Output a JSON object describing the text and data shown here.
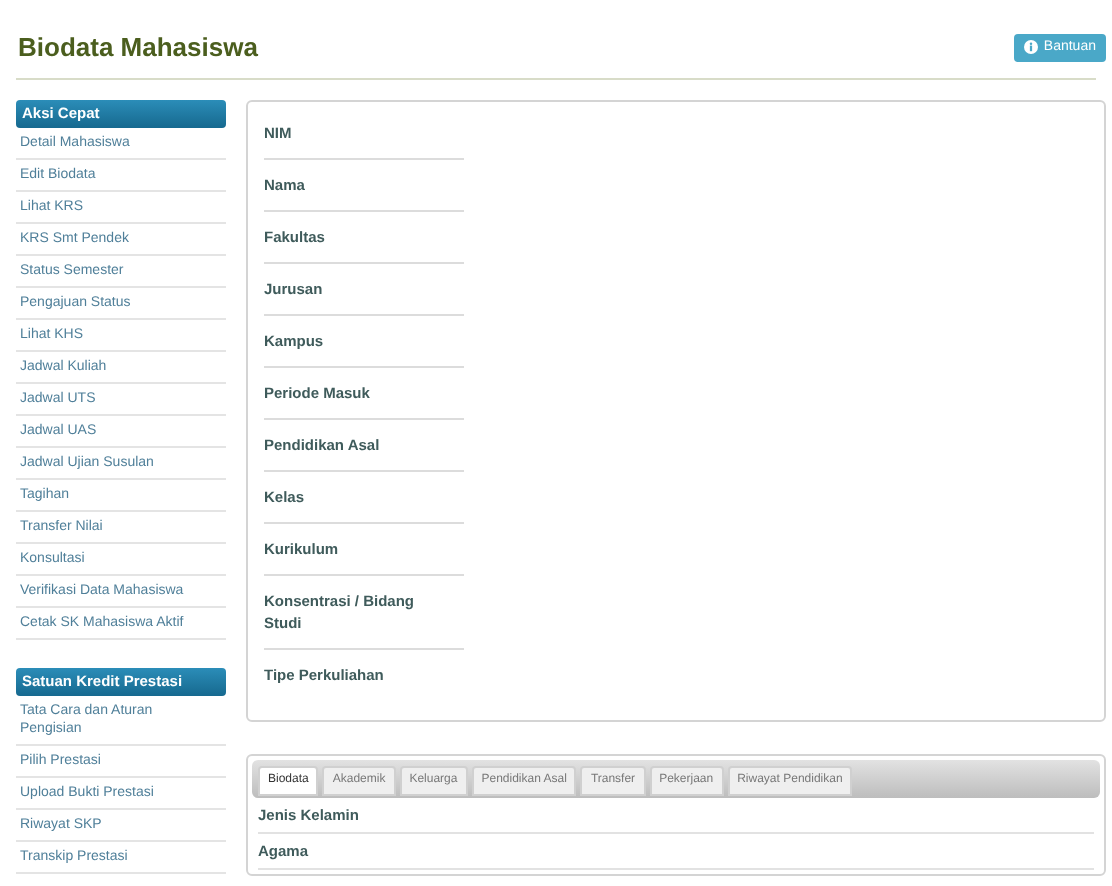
{
  "page_title": "Biodata Mahasiswa",
  "help_button": "Bantuan",
  "sidebar": [
    {
      "title": "Aksi Cepat",
      "items": [
        "Detail Mahasiswa",
        "Edit Biodata",
        "Lihat KRS",
        "KRS Smt Pendek",
        "Status Semester",
        "Pengajuan Status",
        "Lihat KHS",
        "Jadwal Kuliah",
        "Jadwal UTS",
        "Jadwal UAS",
        "Jadwal Ujian Susulan",
        "Tagihan",
        "Transfer Nilai",
        "Konsultasi",
        "Verifikasi Data Mahasiswa",
        "Cetak SK Mahasiswa Aktif"
      ]
    },
    {
      "title": "Satuan Kredit Prestasi",
      "items": [
        "Tata Cara dan Aturan Pengisian",
        "Pilih Prestasi",
        "Upload Bukti Prestasi",
        "Riwayat SKP",
        "Transkip Prestasi"
      ]
    }
  ],
  "profile_fields": [
    "NIM",
    "Nama",
    "Fakultas",
    "Jurusan",
    "Kampus",
    "Periode Masuk",
    "Pendidikan Asal",
    "Kelas",
    "Kurikulum",
    "Konsentrasi / Bidang Studi",
    "Tipe Perkuliahan"
  ],
  "tabs": [
    {
      "label": "Biodata",
      "selected": true
    },
    {
      "label": "Akademik",
      "selected": false
    },
    {
      "label": "Keluarga",
      "selected": false
    },
    {
      "label": "Pendidikan Asal",
      "selected": false
    },
    {
      "label": "Transfer",
      "selected": false
    },
    {
      "label": "Pekerjaan",
      "selected": false
    },
    {
      "label": "Riwayat Pendidikan",
      "selected": false
    }
  ],
  "tab_fields": [
    "Jenis Kelamin",
    "Agama"
  ]
}
